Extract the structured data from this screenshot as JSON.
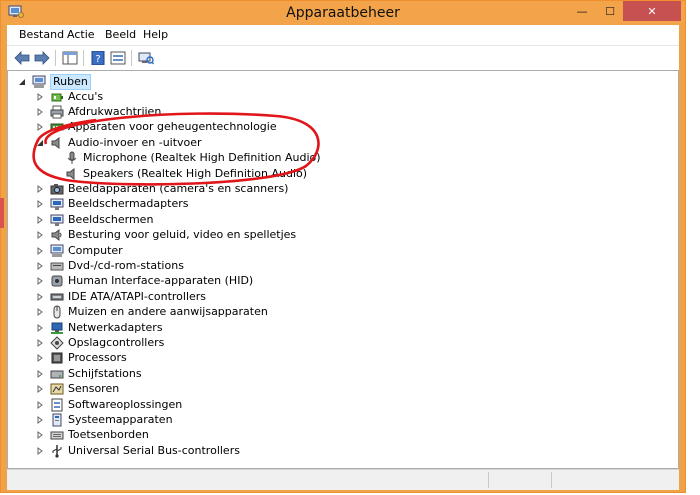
{
  "window": {
    "title": "Apparaatbeheer",
    "minimize": "—",
    "maximize": "☐",
    "close": "✕"
  },
  "menu": [
    "Bestand",
    "Actie",
    "Beeld",
    "Help"
  ],
  "tree": {
    "root": "Ruben",
    "expanded_category": {
      "label": "Audio-invoer en -uitvoer",
      "children": [
        "Microphone (Realtek High Definition Audio)",
        "Speakers (Realtek High Definition Audio)"
      ]
    },
    "categories": [
      {
        "label": "Accu's",
        "icon": "battery-icon"
      },
      {
        "label": "Afdrukwachtrijen",
        "icon": "printer-icon"
      },
      {
        "label": "Apparaten voor geheugentechnologie",
        "icon": "memory-device-icon"
      },
      {
        "label": "Audio-invoer en -uitvoer",
        "icon": "speaker-icon"
      },
      {
        "label": "Beeldapparaten (camera's en scanners)",
        "icon": "camera-icon"
      },
      {
        "label": "Beeldschermadapters",
        "icon": "display-adapter-icon"
      },
      {
        "label": "Beeldschermen",
        "icon": "monitor-icon"
      },
      {
        "label": "Besturing voor geluid, video en spelletjes",
        "icon": "sound-icon"
      },
      {
        "label": "Computer",
        "icon": "computer-icon"
      },
      {
        "label": "Dvd-/cd-rom-stations",
        "icon": "disc-drive-icon"
      },
      {
        "label": "Human Interface-apparaten (HID)",
        "icon": "hid-icon"
      },
      {
        "label": "IDE ATA/ATAPI-controllers",
        "icon": "ide-controller-icon"
      },
      {
        "label": "Muizen en andere aanwijsapparaten",
        "icon": "mouse-icon"
      },
      {
        "label": "Netwerkadapters",
        "icon": "network-adapter-icon"
      },
      {
        "label": "Opslagcontrollers",
        "icon": "storage-controller-icon"
      },
      {
        "label": "Processors",
        "icon": "processor-icon"
      },
      {
        "label": "Schijfstations",
        "icon": "disk-drive-icon"
      },
      {
        "label": "Sensoren",
        "icon": "sensor-icon"
      },
      {
        "label": "Softwareoplossingen",
        "icon": "software-icon"
      },
      {
        "label": "Systeemapparaten",
        "icon": "system-device-icon"
      },
      {
        "label": "Toetsenborden",
        "icon": "keyboard-icon"
      },
      {
        "label": "Universal Serial Bus-controllers",
        "icon": "usb-icon"
      }
    ]
  },
  "colors": {
    "title_bar": "#f3a34a",
    "close_button": "#c75050",
    "selection": "#cce8ff",
    "annotation": "#e0161b"
  }
}
